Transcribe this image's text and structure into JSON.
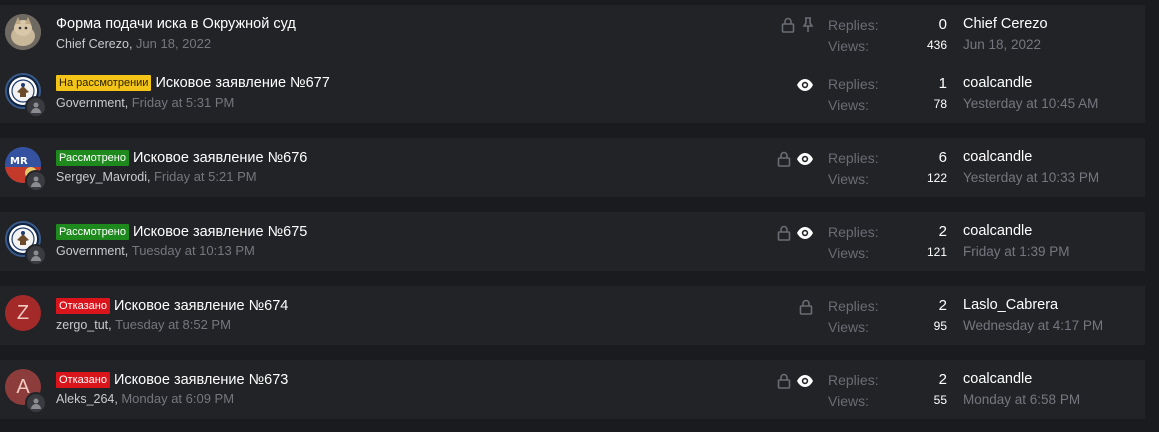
{
  "stats_labels": {
    "replies": "Replies:",
    "views": "Views:"
  },
  "threads": [
    {
      "prefix": "",
      "title": "Форма подачи иска в Окружной суд",
      "author": "Chief Cerezo",
      "date": "Jun 18, 2022",
      "replies": "0",
      "views": "436",
      "last_user": "Chief Cerezo",
      "last_date": "Jun 18, 2022",
      "icons": [
        "lock-icon",
        "pin-icon"
      ]
    },
    {
      "prefix": "На рассмотрении",
      "prefix_color": "#f4c518",
      "title": "Исковое заявление №677",
      "author": "Government",
      "date": "Friday at 5:31 PM",
      "replies": "1",
      "views": "78",
      "last_user": "coalcandle",
      "last_date": "Yesterday at 10:45 AM",
      "icons": [
        "eye-icon"
      ]
    },
    {
      "prefix": "Рассмотрено",
      "prefix_color": "#1e8a1e",
      "title": "Исковое заявление №676",
      "author": "Sergey_Mavrodi",
      "date": "Friday at 5:21 PM",
      "replies": "6",
      "views": "122",
      "last_user": "coalcandle",
      "last_date": "Yesterday at 10:33 PM",
      "icons": [
        "lock-icon",
        "eye-icon"
      ]
    },
    {
      "prefix": "Рассмотрено",
      "prefix_color": "#1e8a1e",
      "title": "Исковое заявление №675",
      "author": "Government",
      "date": "Tuesday at 10:13 PM",
      "replies": "2",
      "views": "121",
      "last_user": "coalcandle",
      "last_date": "Friday at 1:39 PM",
      "icons": [
        "lock-icon",
        "eye-icon"
      ]
    },
    {
      "prefix": "Отказано",
      "prefix_color": "#d9141b",
      "title": "Исковое заявление №674",
      "author": "zergo_tut",
      "date": "Tuesday at 8:52 PM",
      "replies": "2",
      "views": "95",
      "last_user": "Laslo_Cabrera",
      "last_date": "Wednesday at 4:17 PM",
      "icons": [
        "lock-icon"
      ],
      "avatar_letter": "Z",
      "avatar_color": "#a42a2a"
    },
    {
      "prefix": "Отказано",
      "prefix_color": "#d9141b",
      "title": "Исковое заявление №673",
      "author": "Aleks_264",
      "date": "Monday at 6:09 PM",
      "replies": "2",
      "views": "55",
      "last_user": "coalcandle",
      "last_date": "Monday at 6:58 PM",
      "icons": [
        "lock-icon",
        "eye-icon"
      ],
      "avatar_letter": "A",
      "avatar_color": "#8d3c3c"
    }
  ]
}
